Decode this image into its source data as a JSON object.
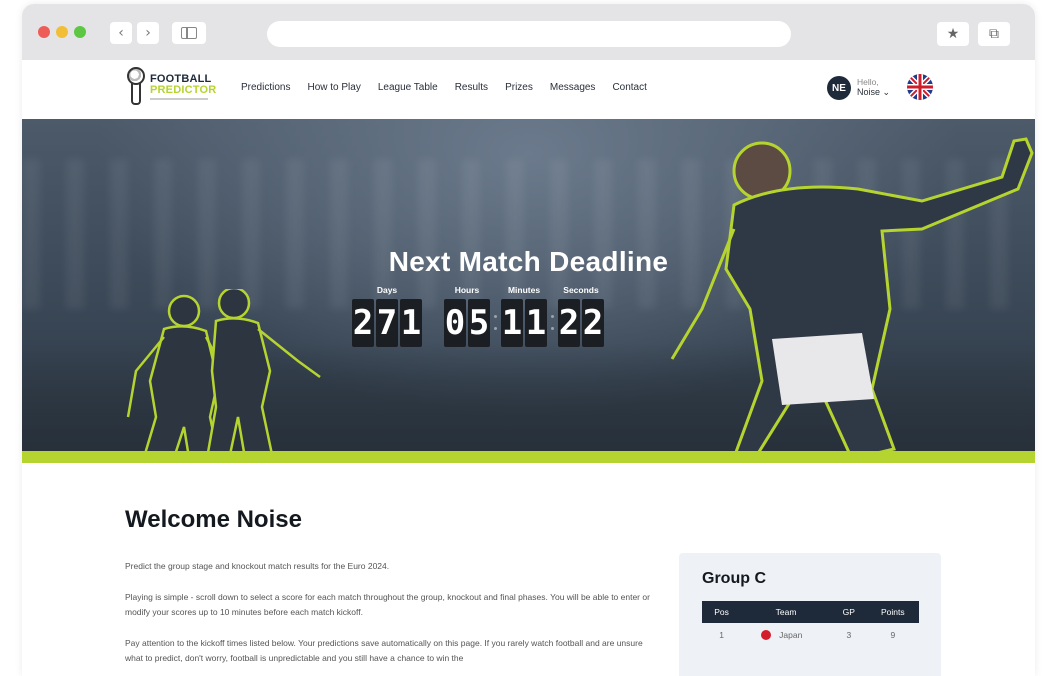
{
  "browser": {
    "back_icon": "chevron-left-icon",
    "forward_icon": "chevron-right-icon",
    "sidebar_icon": "sidebar-icon",
    "bookmark_icon": "star-icon",
    "tabs_icon": "tabs-icon"
  },
  "logo": {
    "line1": "FOOTBALL",
    "line2": "PREDICTOR"
  },
  "nav": {
    "items": [
      "Predictions",
      "How to Play",
      "League Table",
      "Results",
      "Prizes",
      "Messages",
      "Contact"
    ]
  },
  "user": {
    "initials": "NE",
    "greeting": "Hello,",
    "name": "Noise ⌄"
  },
  "hero": {
    "title": "Next Match Deadline",
    "labels": {
      "days": "Days",
      "hours": "Hours",
      "minutes": "Minutes",
      "seconds": "Seconds"
    },
    "days": [
      "2",
      "7",
      "1"
    ],
    "hours": [
      "0",
      "5"
    ],
    "minutes": [
      "1",
      "1"
    ],
    "seconds": [
      "2",
      "2"
    ]
  },
  "welcome": {
    "heading": "Welcome Noise",
    "p1": "Predict the group stage and knockout match results for the Euro 2024.",
    "p2": "Playing is simple - scroll down to select a score for each match throughout the group, knockout and final phases. You will be able to enter or modify your scores up to 10 minutes before each match kickoff.",
    "p3": "Pay attention to the kickoff times listed below. Your predictions save automatically on this page. If you rarely watch football and are unsure what to predict, don't worry, football is unpredictable and you still have a chance to win the"
  },
  "group": {
    "title": "Group C",
    "columns": [
      "Pos",
      "Team",
      "GP",
      "Points"
    ],
    "rows": [
      {
        "pos": "1",
        "team": "Japan",
        "gp": "3",
        "points": "9"
      }
    ]
  },
  "colors": {
    "accent": "#b6d430",
    "navy": "#1e2a3a"
  }
}
